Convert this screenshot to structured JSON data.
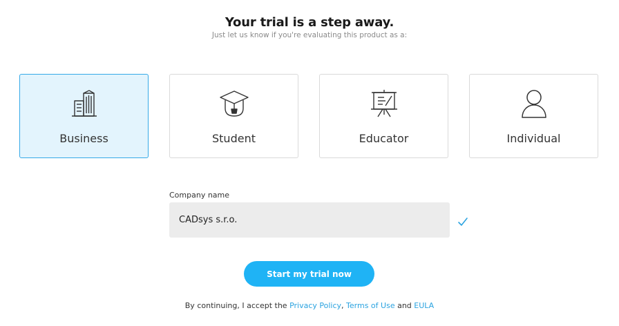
{
  "header": {
    "title": "Your trial is a step away.",
    "subtitle": "Just let us know if you're evaluating this product as a:"
  },
  "options": [
    {
      "label": "Business",
      "icon": "building-icon",
      "selected": true
    },
    {
      "label": "Student",
      "icon": "graduation-cap-icon",
      "selected": false
    },
    {
      "label": "Educator",
      "icon": "presentation-board-icon",
      "selected": false
    },
    {
      "label": "Individual",
      "icon": "person-icon",
      "selected": false
    }
  ],
  "form": {
    "company_label": "Company name",
    "company_value": "CADsys s.r.o.",
    "valid_icon": "check-icon"
  },
  "cta": {
    "label": "Start my trial now"
  },
  "terms": {
    "prefix": "By continuing, I accept the ",
    "privacy": "Privacy Policy",
    "comma": ", ",
    "terms_of_use": "Terms of Use",
    "and": " and ",
    "eula": "EULA"
  },
  "colors": {
    "accent": "#1fb3f5",
    "link": "#2ba3e0",
    "selected_bg": "#e3f4fd",
    "selected_border": "#34a9e8",
    "input_bg": "#ececec"
  }
}
